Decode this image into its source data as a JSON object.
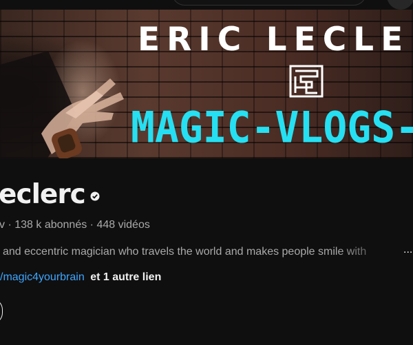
{
  "banner": {
    "title": "ERIC LECLE",
    "subtitle": "MAGIC-VLOGS-PRA"
  },
  "channel": {
    "name": "eclerc",
    "handle_tail": "v",
    "subscribers": "138 k abonnés",
    "videos": "448 vidéos",
    "separator": "·",
    "description": "and eccentric magician who travels the world and makes people smile with",
    "more": "...",
    "link": "/magic4yourbrain",
    "more_links": "et 1 autre lien"
  },
  "colors": {
    "background": "#0f0f0f",
    "link": "#3ea6ff",
    "banner_accent": "#25e0f2",
    "muted_text": "#aaaaaa"
  },
  "icons": {
    "verified": "verified-check-icon",
    "banner_logo": "maze-logo-icon"
  }
}
